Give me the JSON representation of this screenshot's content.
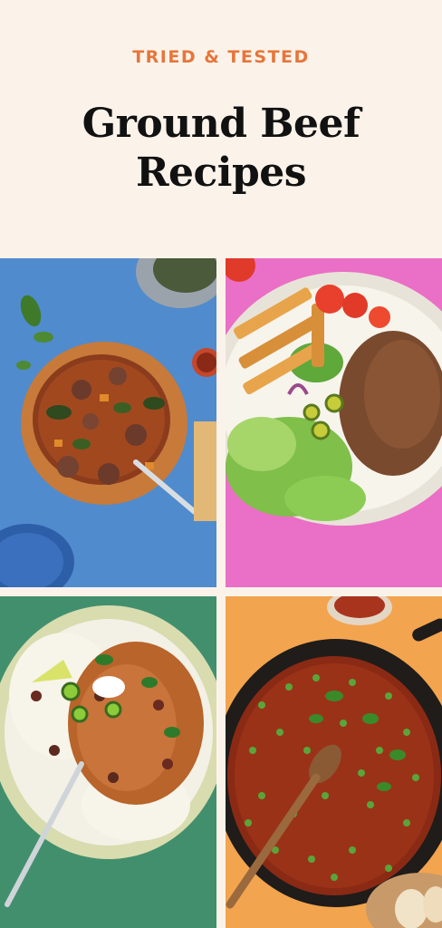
{
  "header": {
    "eyebrow": "TRIED & TESTED",
    "title_line1": "Ground Beef",
    "title_line2": "Recipes"
  },
  "photos": [
    {
      "subject": "beef-and-vegetable-stew",
      "background": "#4a86c9"
    },
    {
      "subject": "ground-beef-taco-salad-with-fries",
      "background": "#e86ac2"
    },
    {
      "subject": "ground-beef-and-beans-over-rice",
      "background": "#3f8a6a"
    },
    {
      "subject": "ground-beef-and-peas-skillet",
      "background": "#f2a04a"
    }
  ]
}
